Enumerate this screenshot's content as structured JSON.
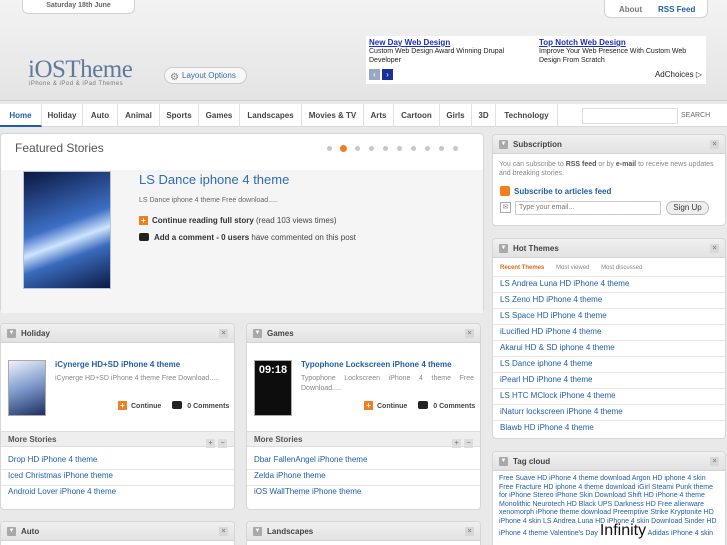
{
  "header": {
    "date": "Saturday 18th June",
    "about": "About",
    "rss": "RSS Feed",
    "logo": "iOSTheme",
    "logo_sub": "iPhone & iPod & iPad Themes",
    "layout_options": "Layout Options"
  },
  "ad": {
    "left_title": "New Day Web Design",
    "left_text": "Custom Web Design Award Winning Drupal Developer",
    "right_title": "Top Notch Web Design",
    "right_text": "Improve Your Web Presence With Custom Web Design From Scratch",
    "adchoices": "AdChoices ▷"
  },
  "nav": {
    "items": [
      "Home",
      "Holiday",
      "Auto",
      "Animal",
      "Sports",
      "Games",
      "Landscapes",
      "Movies & TV",
      "Arts",
      "Cartoon",
      "Girls",
      "3D",
      "Technology"
    ],
    "search": "SEARCH"
  },
  "featured": {
    "heading": "Featured Stories",
    "title": "LS Dance iphone 4 theme",
    "desc": "LS Dance iphone 4 theme Free download.....",
    "continue": "Continue reading full story",
    "views": "(read 103 views times)",
    "add_comment": "Add a comment",
    "users": "- 0 users",
    "commented": "have commented on this post"
  },
  "holiday": {
    "title": "Holiday",
    "post_title": "iCynerge HD+SD iPhone 4 theme",
    "post_desc": "iCynerge HD+SD iPhone 4 theme Free Download.....",
    "continue": "Continue",
    "comments": "0 Comments",
    "more": "More Stories",
    "links": [
      "Drop HD iPhone 4 theme",
      "Iced Christmas iPhone theme",
      "Android Lover iPhone 4 theme"
    ]
  },
  "games": {
    "title": "Games",
    "post_title": "Typophone Lockscreen iPhone 4 theme",
    "post_desc": "Typophone Lockscreen iPhone 4 theme Free Download.....",
    "thumb_time": "09:18",
    "continue": "Continue",
    "comments": "0 Comments",
    "more": "More Stories",
    "links": [
      "Dbar FallenAngel iPhone theme",
      "Zelda iPhone theme",
      "iOS WallTheme iPhone theme"
    ]
  },
  "auto": {
    "title": "Auto"
  },
  "landscapes": {
    "title": "Landscapes"
  },
  "subscription": {
    "title": "Subscription",
    "text1": "You can subscribe to",
    "rss": "RSS feed",
    "text2": "or by",
    "email": "e-mail",
    "text3": "to receive news updates and breaking stories.",
    "subscribe_link": "Subscribe to articles feed",
    "email_placeholder": "Type your email...",
    "signup": "Sign Up"
  },
  "hot": {
    "title": "Hot Themes",
    "tabs": [
      "Recent Themes",
      "Most viewed",
      "Most discussed"
    ],
    "items": [
      "LS Andrea Luna HD iPhone 4 theme",
      "LS Zeno HD iPhone 4 theme",
      "LS Space HD iPhone 4 theme",
      "iLucified HD iPhone 4 theme",
      "Akarui HD & SD iphone 4 theme",
      "LS Dance iphone 4 theme",
      "iPearl HD iPhone 4 theme",
      "LS HTC MClock iPhone 4 theme",
      "iNaturr lockscreen iPhone 4 theme",
      "Blawb HD iPhone 4 theme"
    ]
  },
  "tagcloud": {
    "title": "Tag cloud",
    "text": "Free Suave HD iPhone 4 theme download Argon HD iphone 4 skin Free Fracture HD iphone 4 theme download iGirl Steami Punk theme for iPhone Stereo iPhone Skin Download Shift HD iPhone 4 theme Monolithic Neurotech HD Black UPS Darkness HD Free alienware xenomorph iPhone theme download Preemptive Strike Kryptonite HD iPhone 4 skin LS Andrea Luna HD iPhone 4 skin Download Sinder HD iPhone 4 theme Valentine's Day",
    "big": "Infinity",
    "tail": "Adidas iPhone 4 skin"
  },
  "colors": {
    "accent": "#1f5fa8",
    "orange": "#f07f1e"
  }
}
